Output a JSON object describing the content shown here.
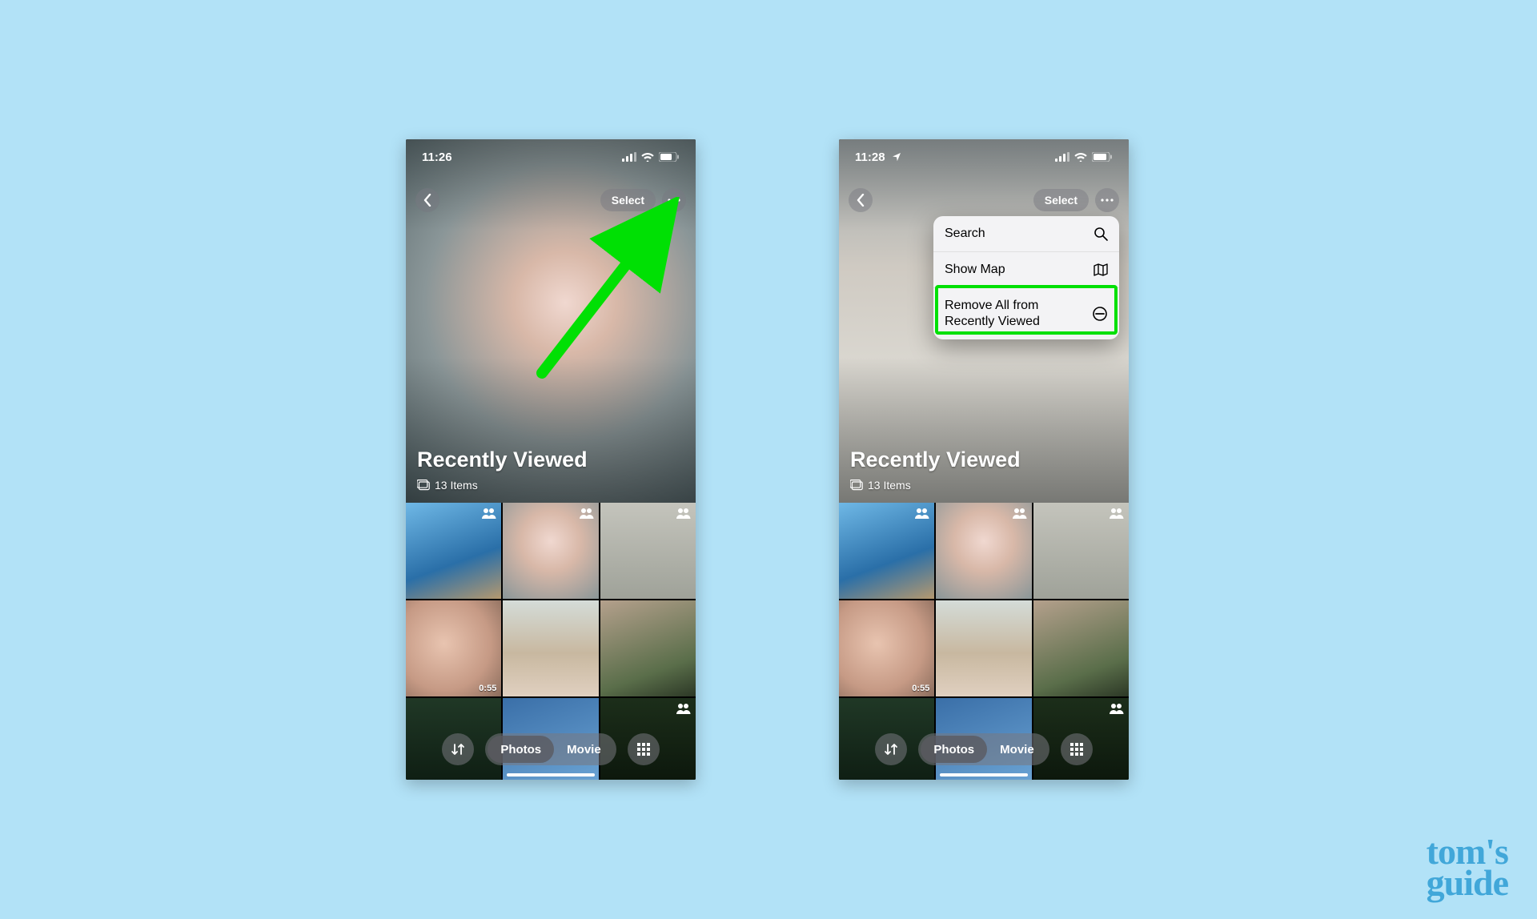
{
  "watermark": {
    "line1": "tom's",
    "line2": "guide"
  },
  "left": {
    "status": {
      "time": "11:26"
    },
    "toolbar": {
      "select_label": "Select"
    },
    "hero": {
      "title": "Recently Viewed",
      "count": "13 Items"
    },
    "grid": {
      "video_duration": "0:55"
    },
    "bottom": {
      "photos_label": "Photos",
      "movie_label": "Movie"
    }
  },
  "right": {
    "status": {
      "time": "11:28"
    },
    "toolbar": {
      "select_label": "Select"
    },
    "hero": {
      "title": "Recently Viewed",
      "count": "13 Items"
    },
    "grid": {
      "video_duration": "0:55"
    },
    "bottom": {
      "photos_label": "Photos",
      "movie_label": "Movie"
    },
    "menu": {
      "search_label": "Search",
      "showmap_label": "Show Map",
      "remove_label": "Remove All from Recently Viewed"
    }
  }
}
